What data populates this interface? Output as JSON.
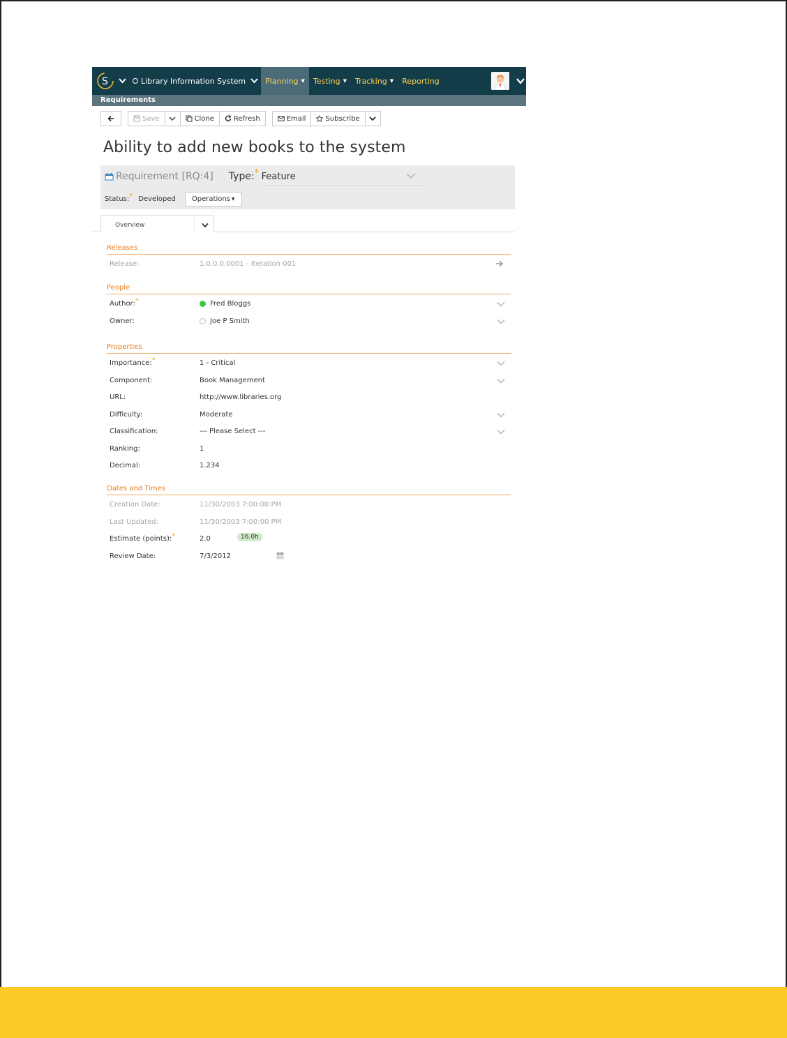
{
  "nav": {
    "project": "Library Information System",
    "menu": [
      {
        "label": "Planning"
      },
      {
        "label": "Testing"
      },
      {
        "label": "Tracking"
      },
      {
        "label": "Reporting"
      }
    ],
    "subbar": "Requirements"
  },
  "toolbar": {
    "save": "Save",
    "clone": "Clone",
    "refresh": "Refresh",
    "email": "Email",
    "subscribe": "Subscribe"
  },
  "title": "Ability to add new books to the system",
  "header": {
    "requirement_label": "Requirement [RQ:4]",
    "type_label": "Type:",
    "type_value": "Feature",
    "status_label": "Status:",
    "status_value": "Developed",
    "operations": "Operations"
  },
  "tab": {
    "label": "Overview"
  },
  "releases": {
    "title": "Releases",
    "release_label": "Release:",
    "release_value": "1.0.0.0.0001 - Iteration 001"
  },
  "people": {
    "title": "People",
    "author_label": "Author:",
    "author_value": "Fred Bloggs",
    "owner_label": "Owner:",
    "owner_value": "Joe P Smith"
  },
  "properties": {
    "title": "Properties",
    "importance_label": "Importance:",
    "importance_value": "1 - Critical",
    "component_label": "Component:",
    "component_value": "Book Management",
    "url_label": "URL:",
    "url_value": "http://www.libraries.org",
    "difficulty_label": "Difficulty:",
    "difficulty_value": "Moderate",
    "classification_label": "Classification:",
    "classification_value": "--- Please Select ---",
    "ranking_label": "Ranking:",
    "ranking_value": "1",
    "decimal_label": "Decimal:",
    "decimal_value": "1.234"
  },
  "dates": {
    "title": "Dates and Times",
    "creation_label": "Creation Date:",
    "creation_value": "11/30/2003 7:00:00 PM",
    "updated_label": "Last Updated:",
    "updated_value": "11/30/2003 7:00:00 PM",
    "estimate_label": "Estimate (points):",
    "estimate_value": "2.0",
    "estimate_badge": "16.0h",
    "review_label": "Review Date:",
    "review_value": "7/3/2012"
  },
  "colors": {
    "navbar": "#143d4a",
    "accent": "#e67e22",
    "footer": "#fccb28"
  }
}
